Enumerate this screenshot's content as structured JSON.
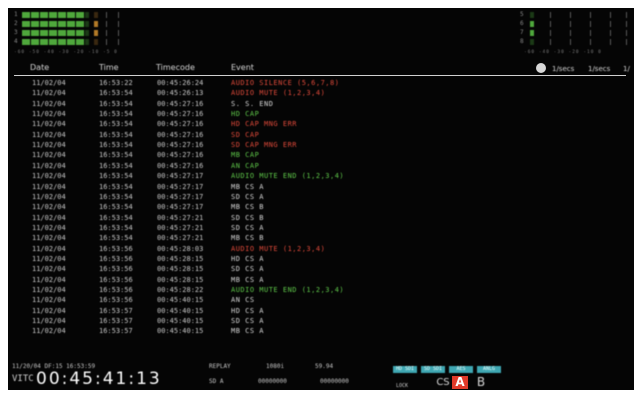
{
  "meters_left": {
    "channels": [
      "1",
      "2",
      "3",
      "4"
    ],
    "scale": "-60 -50 -40 -30 -20 -10 -5 0"
  },
  "meters_right": {
    "channels": [
      "5",
      "6",
      "7",
      "8"
    ],
    "scale": "-60 -40 -30 -20 -10 0"
  },
  "header": {
    "date": "Date",
    "time": "Time",
    "timecode": "Timecode",
    "event": "Event",
    "rate1": "1/secs",
    "rate2": "1/secs",
    "rate3": "1/"
  },
  "log": [
    {
      "date": "11/02/04",
      "time": "16:53:22",
      "tc": "00:45:26:24",
      "event": "AUDIO SILENCE (5,6,7,8)",
      "color": "red"
    },
    {
      "date": "11/02/04",
      "time": "16:53:54",
      "tc": "00:45:26:13",
      "event": "AUDIO MUTE (1,2,3,4)",
      "color": "red"
    },
    {
      "date": "11/02/04",
      "time": "16:53:54",
      "tc": "00:45:27:16",
      "event": "S. S. END",
      "color": "white"
    },
    {
      "date": "11/02/04",
      "time": "16:53:54",
      "tc": "00:45:27:16",
      "event": "HD CAP",
      "color": "green"
    },
    {
      "date": "11/02/04",
      "time": "16:53:54",
      "tc": "00:45:27:16",
      "event": "HD CAP MNG ERR",
      "color": "red"
    },
    {
      "date": "11/02/04",
      "time": "16:53:54",
      "tc": "00:45:27:16",
      "event": "SD CAP",
      "color": "red"
    },
    {
      "date": "11/02/04",
      "time": "16:53:54",
      "tc": "00:45:27:16",
      "event": "SD CAP MNG ERR",
      "color": "red"
    },
    {
      "date": "11/02/04",
      "time": "16:53:54",
      "tc": "00:45:27:16",
      "event": "MB CAP",
      "color": "green"
    },
    {
      "date": "11/02/04",
      "time": "16:53:54",
      "tc": "00:45:27:16",
      "event": "AN CAP",
      "color": "green"
    },
    {
      "date": "11/02/04",
      "time": "16:53:54",
      "tc": "00:45:27:17",
      "event": "AUDIO MUTE END (1,2,3,4)",
      "color": "green"
    },
    {
      "date": "11/02/04",
      "time": "16:53:54",
      "tc": "00:45:27:17",
      "event": "MB CS A",
      "color": "white"
    },
    {
      "date": "11/02/04",
      "time": "16:53:54",
      "tc": "00:45:27:17",
      "event": "SD CS A",
      "color": "white"
    },
    {
      "date": "11/02/04",
      "time": "16:53:54",
      "tc": "00:45:27:17",
      "event": "MB CS B",
      "color": "white"
    },
    {
      "date": "11/02/04",
      "time": "16:53:54",
      "tc": "00:45:27:21",
      "event": "SD CS B",
      "color": "white"
    },
    {
      "date": "11/02/04",
      "time": "16:53:54",
      "tc": "00:45:27:21",
      "event": "SD CS A",
      "color": "white"
    },
    {
      "date": "11/02/04",
      "time": "16:53:54",
      "tc": "00:45:27:21",
      "event": "MB CS B",
      "color": "white"
    },
    {
      "date": "11/02/04",
      "time": "16:53:56",
      "tc": "00:45:28:03",
      "event": "AUDIO MUTE (1,2,3,4)",
      "color": "red"
    },
    {
      "date": "11/02/04",
      "time": "16:53:56",
      "tc": "00:45:28:15",
      "event": "HD CS A",
      "color": "white"
    },
    {
      "date": "11/02/04",
      "time": "16:53:56",
      "tc": "00:45:28:15",
      "event": "SD CS A",
      "color": "white"
    },
    {
      "date": "11/02/04",
      "time": "16:53:56",
      "tc": "00:45:28:15",
      "event": "MB CS A",
      "color": "white"
    },
    {
      "date": "11/02/04",
      "time": "16:53:56",
      "tc": "00:45:28:22",
      "event": "AUDIO MUTE END (1,2,3,4)",
      "color": "green"
    },
    {
      "date": "11/02/04",
      "time": "16:53:56",
      "tc": "00:45:40:15",
      "event": "AN CS",
      "color": "white"
    },
    {
      "date": "11/02/04",
      "time": "16:53:57",
      "tc": "00:45:40:15",
      "event": "HD CS A",
      "color": "white"
    },
    {
      "date": "11/02/04",
      "time": "16:53:57",
      "tc": "00:45:40:15",
      "event": "SD CS A",
      "color": "white"
    },
    {
      "date": "11/02/04",
      "time": "16:53:57",
      "tc": "00:45:40:15",
      "event": "MB CS A",
      "color": "white"
    }
  ],
  "status": {
    "line1": "11/20/04 DF:15  16:53:59",
    "mode": "REPLAY",
    "info1": "1080i",
    "info2": "59.94",
    "vitc_label": "VITC",
    "timecode": "00:45:41:13",
    "fmt1": "SD   A",
    "fmt2": "00000000",
    "fmt3": "00000000",
    "chips": [
      "HD SDI",
      "SD SDI",
      "AES",
      "ANLG"
    ],
    "lock_label": "LOCK",
    "cs_label": "CS",
    "a_label": "A",
    "b_label": "B"
  },
  "colors": {
    "red": "#e04a3a",
    "green": "#5fc84a",
    "white": "#d8d8d8",
    "chip": "#3fa7b2",
    "a_bg": "#e03a2a"
  }
}
